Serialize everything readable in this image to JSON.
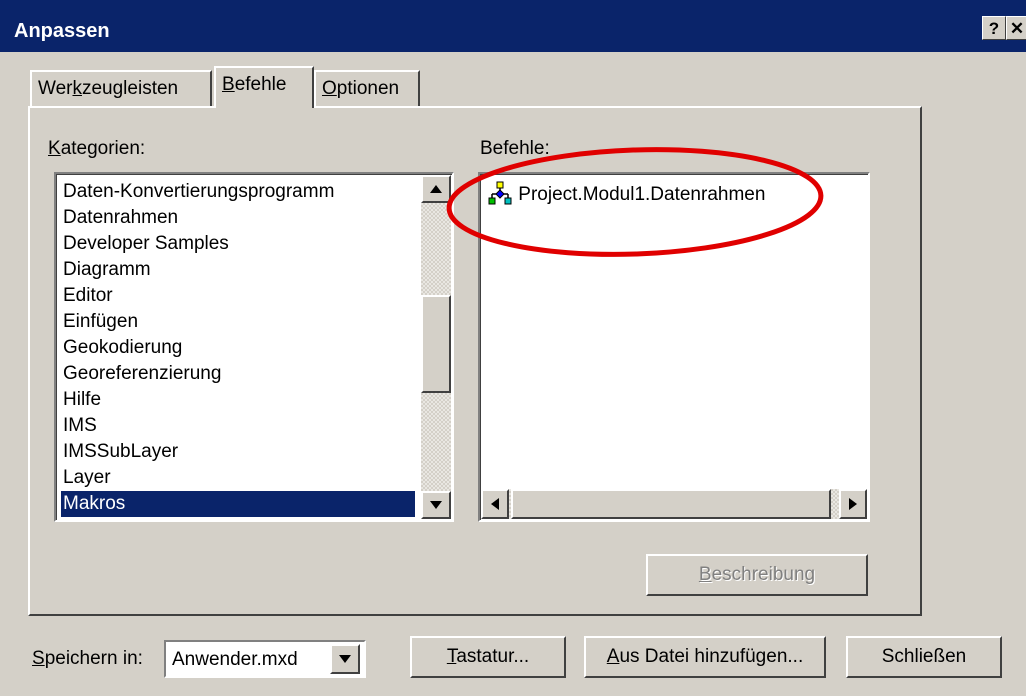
{
  "window": {
    "title": "Anpassen",
    "help_label": "?",
    "close_label": "✕"
  },
  "tabs": [
    {
      "pre": "Wer",
      "key": "k",
      "post": "zeugleisten"
    },
    {
      "pre": "",
      "key": "B",
      "post": "efehle"
    },
    {
      "pre": "",
      "key": "O",
      "post": "ptionen"
    }
  ],
  "active_tab": "Befehle",
  "categories": {
    "label_key": "K",
    "label_rest": "ategorien:",
    "items": [
      "Daten-Konvertierungsprogramm",
      "Datenrahmen",
      "Developer Samples",
      "Diagramm",
      "Editor",
      "Einfügen",
      "Geokodierung",
      "Georeferenzierung",
      "Hilfe",
      "IMS",
      "IMSSubLayer",
      "Layer",
      "Makros"
    ],
    "selected": "Makros"
  },
  "commands": {
    "label": "Befehle:",
    "items": [
      "Project.Modul1.Datenrahmen"
    ],
    "item_icon": "macro-icon"
  },
  "buttons": {
    "description": {
      "key": "B",
      "rest": "eschreibung"
    },
    "keyboard": {
      "key": "T",
      "rest": "astatur..."
    },
    "add_from_file": {
      "key": "A",
      "rest": "us Datei hinzufügen..."
    },
    "close": "Schließen"
  },
  "save_in": {
    "label_key": "S",
    "label_rest": "peichern in:",
    "value": "Anwender.mxd"
  },
  "colors": {
    "titlebar": "#0a246a",
    "selection": "#0a246a",
    "highlight_ellipse": "#e00000",
    "face": "#d4d0c8"
  }
}
